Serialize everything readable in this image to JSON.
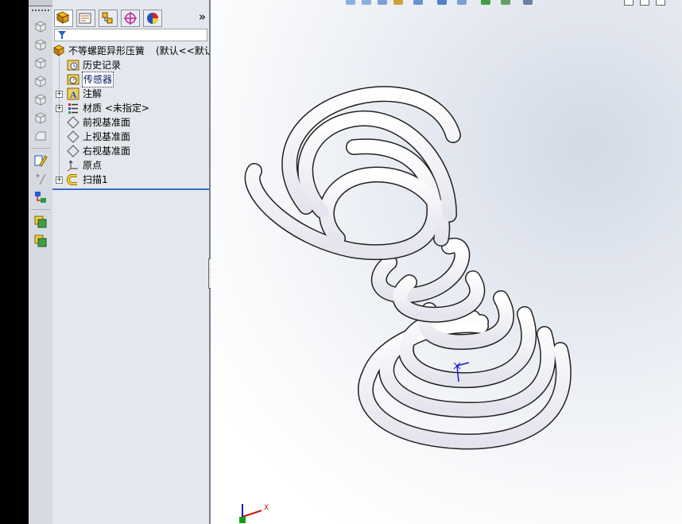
{
  "tree": {
    "root": {
      "label": "不等螺距异形压簧",
      "config": "(默认<<默认"
    },
    "items": [
      {
        "label": "历史记录",
        "icon": "history-icon"
      },
      {
        "label": "传感器",
        "icon": "sensor-icon",
        "selected": true
      },
      {
        "label": "注解",
        "icon": "annotation-icon",
        "expandable": true
      },
      {
        "label": "材质 <未指定>",
        "icon": "material-icon",
        "expandable": true
      },
      {
        "label": "前视基准面",
        "icon": "plane-icon"
      },
      {
        "label": "上视基准面",
        "icon": "plane-icon"
      },
      {
        "label": "右视基准面",
        "icon": "plane-icon"
      },
      {
        "label": "原点",
        "icon": "origin-icon"
      },
      {
        "label": "扫描1",
        "icon": "sweep-icon",
        "expandable": true
      }
    ]
  },
  "panel": {
    "more_label": "»"
  },
  "viewport": {
    "triad_x_label": "X"
  },
  "colors": {
    "selection_line": "#3a6ec7",
    "triad_x": "#d01010",
    "triad_y": "#1010d0",
    "triad_z": "#10a010"
  }
}
